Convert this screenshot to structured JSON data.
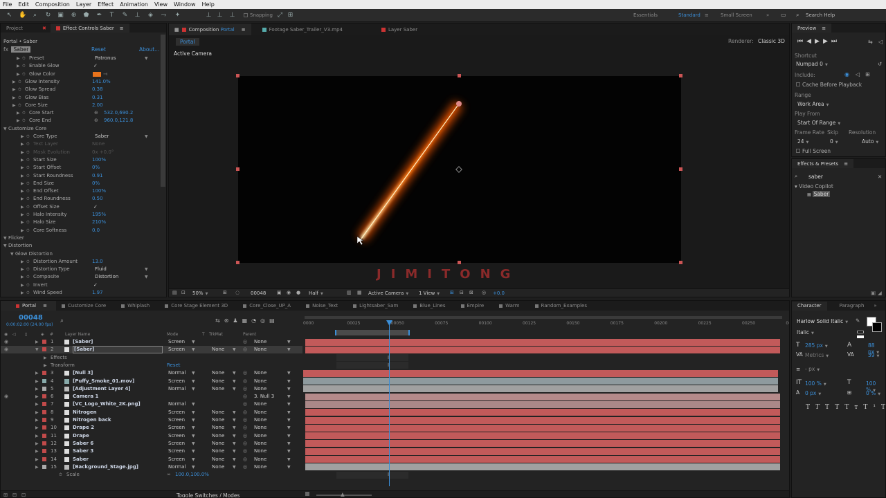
{
  "menu": [
    "File",
    "Edit",
    "Composition",
    "Layer",
    "Effect",
    "Animation",
    "View",
    "Window",
    "Help"
  ],
  "toolbar": {
    "snapping": "Snapping",
    "workspaces": [
      "Essentials",
      "Standard",
      "Small Screen"
    ],
    "search": "Search Help"
  },
  "left_panel": {
    "tab_project": "Project",
    "tab_effects": "Effect Controls Saber",
    "breadcrumb": "Portal • Saber",
    "effect_name": "Saber",
    "reset": "Reset",
    "about": "About...",
    "rows": [
      {
        "label": "Preset",
        "value": "Patronus",
        "indent": 2,
        "kind": "dropdown"
      },
      {
        "label": "Enable Glow",
        "value": "✓",
        "indent": 2,
        "kind": "check"
      },
      {
        "label": "Glow Color",
        "value": "",
        "indent": 2,
        "kind": "color"
      },
      {
        "label": "Glow Intensity",
        "value": "141.0%",
        "indent": 1,
        "kind": "num"
      },
      {
        "label": "Glow Spread",
        "value": "0.38",
        "indent": 1,
        "kind": "num"
      },
      {
        "label": "Glow Bias",
        "value": "0.31",
        "indent": 1,
        "kind": "num"
      },
      {
        "label": "Core Size",
        "value": "2.00",
        "indent": 1,
        "kind": "num"
      },
      {
        "label": "Core Start",
        "value": "532.0,690.2",
        "indent": 2,
        "kind": "point"
      },
      {
        "label": "Core End",
        "value": "960.0,121.8",
        "indent": 2,
        "kind": "point"
      },
      {
        "label": "Customize Core",
        "value": "",
        "indent": 0,
        "kind": "group"
      },
      {
        "label": "Core Type",
        "value": "Saber",
        "indent": 3,
        "kind": "dropdown"
      },
      {
        "label": "Text Layer",
        "value": "None",
        "indent": 3,
        "kind": "dim"
      },
      {
        "label": "Mask Evolution",
        "value": "0x +0.0°",
        "indent": 3,
        "kind": "dim"
      },
      {
        "label": "Start Size",
        "value": "100%",
        "indent": 3,
        "kind": "num"
      },
      {
        "label": "Start Offset",
        "value": "0%",
        "indent": 3,
        "kind": "num"
      },
      {
        "label": "Start Roundness",
        "value": "0.91",
        "indent": 3,
        "kind": "num"
      },
      {
        "label": "End Size",
        "value": "0%",
        "indent": 3,
        "kind": "num"
      },
      {
        "label": "End Offset",
        "value": "100%",
        "indent": 3,
        "kind": "num"
      },
      {
        "label": "End Roundness",
        "value": "0.50",
        "indent": 3,
        "kind": "num"
      },
      {
        "label": "Offset Size",
        "value": "✓",
        "indent": 3,
        "kind": "check"
      },
      {
        "label": "Halo Intensity",
        "value": "195%",
        "indent": 3,
        "kind": "num"
      },
      {
        "label": "Halo Size",
        "value": "210%",
        "indent": 3,
        "kind": "num"
      },
      {
        "label": "Core Softness",
        "value": "0.0",
        "indent": 3,
        "kind": "num"
      },
      {
        "label": "Flicker",
        "value": "",
        "indent": 0,
        "kind": "group"
      },
      {
        "label": "Distortion",
        "value": "",
        "indent": 0,
        "kind": "group"
      },
      {
        "label": "Glow Distortion",
        "value": "",
        "indent": 1,
        "kind": "group"
      },
      {
        "label": "Distortion Amount",
        "value": "13.0",
        "indent": 3,
        "kind": "num"
      },
      {
        "label": "Distortion Type",
        "value": "Fluid",
        "indent": 3,
        "kind": "dropdown"
      },
      {
        "label": "Composite",
        "value": "Distortion",
        "indent": 3,
        "kind": "dropdown"
      },
      {
        "label": "Invert",
        "value": "✓",
        "indent": 3,
        "kind": "check"
      },
      {
        "label": "Wind Speed",
        "value": "1.97",
        "indent": 3,
        "kind": "num"
      }
    ]
  },
  "comp": {
    "tabs": [
      "Composition Portal",
      "Footage Saber_Trailer_V3.mp4",
      "Layer Saber"
    ],
    "sub_tab": "Portal",
    "renderer_label": "Renderer:",
    "renderer": "Classic 3D",
    "camera_label": "Active Camera",
    "watermark": "JIMITONG",
    "footer": {
      "zoom": "50%",
      "frame": "00048",
      "resolution": "Half",
      "camera": "Active Camera",
      "views": "1 View",
      "exposure": "+0.0"
    }
  },
  "preview": {
    "title": "Preview",
    "shortcut_label": "Shortcut",
    "shortcut": "Numpad 0",
    "include_label": "Include:",
    "cache": "Cache Before Playback",
    "range_label": "Range",
    "range": "Work Area",
    "play_from_label": "Play From",
    "play_from": "Start Of Range",
    "frame_rate_label": "Frame Rate",
    "skip_label": "Skip",
    "resolution_label": "Resolution",
    "frame_rate": "24",
    "skip": "0",
    "resolution": "Auto",
    "full_screen": "Full Screen"
  },
  "effects_presets": {
    "title": "Effects & Presets",
    "search": "saber",
    "group": "Video Copilot",
    "item": "Saber"
  },
  "character": {
    "tab_char": "Character",
    "tab_para": "Paragraph",
    "font": "Harlow Solid Italic",
    "style": "Italic",
    "size": "285 px",
    "leading": "88 px",
    "kerning": "Metrics",
    "tracking": "39",
    "stroke": "- px",
    "vscale": "100 %",
    "hscale": "100 %",
    "baseline": "0 px",
    "tsume": "0 %"
  },
  "timeline": {
    "tabs": [
      "Portal",
      "Customize Core",
      "Whiplash",
      "Core Stage Element 3D",
      "Core_Close_UP_A",
      "Noise_Text",
      "Lightsaber_Sam",
      "Blue_Lines",
      "Empire",
      "Warm",
      "Random_Examples"
    ],
    "timecode": "00048",
    "timecode_sub": "0:00:02:00 (24.00 fps)",
    "headers": {
      "layer_name": "Layer Name",
      "mode": "Mode",
      "t": "T",
      "trkmat": "TrkMat",
      "parent": "Parent"
    },
    "ruler": [
      "0000",
      "00025",
      "00050",
      "00075",
      "00100",
      "00125",
      "00150",
      "00175",
      "00200",
      "00225",
      "00250",
      "00"
    ],
    "layers": [
      {
        "num": "1",
        "name": "[Saber]",
        "mode": "Screen",
        "trk": "",
        "parent": "None",
        "color": "#c14a4a",
        "bar": "#c25a5a"
      },
      {
        "num": "2",
        "name": "[Saber]",
        "mode": "Screen",
        "trk": "None",
        "parent": "None",
        "color": "#c14a4a",
        "bar": "#c25a5a",
        "selected": true
      },
      {
        "num": "",
        "name": "Effects",
        "mode": "",
        "trk": "",
        "parent": "",
        "color": "",
        "bar": "",
        "sub": true
      },
      {
        "num": "",
        "name": "Transform",
        "mode": "Reset",
        "trk": "",
        "parent": "",
        "color": "",
        "bar": "",
        "sub": true
      },
      {
        "num": "3",
        "name": "[Null 3]",
        "mode": "Normal",
        "trk": "None",
        "parent": "None",
        "color": "#c14a4a",
        "bar": "#c25a5a"
      },
      {
        "num": "4",
        "name": "[Puffy_Smoke_01.mov]",
        "mode": "Screen",
        "trk": "None",
        "parent": "None",
        "color": "#8aa",
        "bar": "#8e9a9e"
      },
      {
        "num": "5",
        "name": "[Adjustment Layer 4]",
        "mode": "Normal",
        "trk": "None",
        "parent": "None",
        "color": "#aaa",
        "bar": "#a0a0a0"
      },
      {
        "num": "6",
        "name": "Camera 1",
        "mode": "",
        "trk": "",
        "parent": "3. Null 3",
        "color": "#c14a4a",
        "bar": "#b58a8a"
      },
      {
        "num": "7",
        "name": "[VC_Logo_White_2K.png]",
        "mode": "Normal",
        "trk": "",
        "parent": "None",
        "color": "#c14a4a",
        "bar": "#a88"
      },
      {
        "num": "8",
        "name": "Nitrogen",
        "mode": "Screen",
        "trk": "None",
        "parent": "None",
        "color": "#c14a4a",
        "bar": "#c25a5a"
      },
      {
        "num": "9",
        "name": "Nitrogen back",
        "mode": "Screen",
        "trk": "None",
        "parent": "None",
        "color": "#c14a4a",
        "bar": "#c25a5a"
      },
      {
        "num": "10",
        "name": "Drape 2",
        "mode": "Screen",
        "trk": "None",
        "parent": "None",
        "color": "#c14a4a",
        "bar": "#c25a5a"
      },
      {
        "num": "11",
        "name": "Drape",
        "mode": "Screen",
        "trk": "None",
        "parent": "None",
        "color": "#c14a4a",
        "bar": "#c25a5a"
      },
      {
        "num": "12",
        "name": "Saber 6",
        "mode": "Screen",
        "trk": "None",
        "parent": "None",
        "color": "#c14a4a",
        "bar": "#c25a5a"
      },
      {
        "num": "13",
        "name": "Saber 3",
        "mode": "Screen",
        "trk": "None",
        "parent": "None",
        "color": "#c14a4a",
        "bar": "#c25a5a"
      },
      {
        "num": "14",
        "name": "Saber",
        "mode": "Screen",
        "trk": "None",
        "parent": "None",
        "color": "#c14a4a",
        "bar": "#c25a5a"
      },
      {
        "num": "15",
        "name": "[Background_Stage.jpg]",
        "mode": "Normal",
        "trk": "None",
        "parent": "None",
        "color": "#aaa",
        "bar": "#a0a0a0"
      },
      {
        "num": "",
        "name": "Scale",
        "mode": "100.0,100.0%",
        "trk": "",
        "parent": "",
        "color": "",
        "bar": "",
        "sub": true
      }
    ],
    "toggle_label": "Toggle Switches / Modes"
  }
}
